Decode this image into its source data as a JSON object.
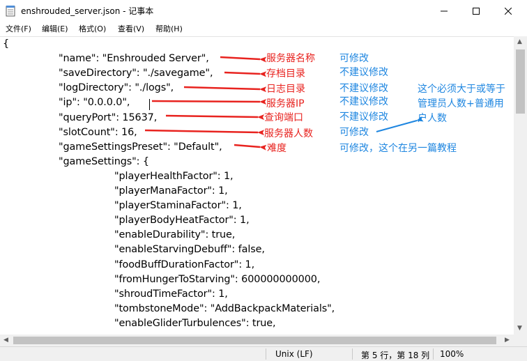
{
  "window": {
    "title": "enshrouded_server.json - 记事本",
    "buttons": {
      "minimize": "minimize",
      "maximize": "maximize",
      "close": "close"
    }
  },
  "menu": [
    "文件(F)",
    "编辑(E)",
    "格式(O)",
    "查看(V)",
    "帮助(H)"
  ],
  "editor": {
    "lines": [
      "{",
      "\t\"name\": \"Enshrouded Server\",",
      "\t\"saveDirectory\": \"./savegame\",",
      "\t\"logDirectory\": \"./logs\",",
      "\t\"ip\": \"0.0.0.0\",",
      "\t\"queryPort\": 15637,",
      "\t\"slotCount\": 16,",
      "\t\"gameSettingsPreset\": \"Default\",",
      "\t\"gameSettings\": {",
      "\t\t\"playerHealthFactor\": 1,",
      "\t\t\"playerManaFactor\": 1,",
      "\t\t\"playerStaminaFactor\": 1,",
      "\t\t\"playerBodyHeatFactor\": 1,",
      "\t\t\"enableDurability\": true,",
      "\t\t\"enableStarvingDebuff\": false,",
      "\t\t\"foodBuffDurationFactor\": 1,",
      "\t\t\"fromHungerToStarving\": 600000000000,",
      "\t\t\"shroudTimeFactor\": 1,",
      "\t\t\"tombstoneMode\": \"AddBackpackMaterials\",",
      "\t\t\"enableGliderTurbulences\": true,"
    ]
  },
  "annotations": {
    "red": [
      "服务器名称",
      "存档目录",
      "日志目录",
      "服务器IP",
      "查询端口",
      "服务器人数",
      "难度"
    ],
    "blue": [
      "可修改",
      "不建议修改",
      "不建议修改",
      "不建议修改",
      "不建议修改",
      "可修改",
      "可修改，这个在另一篇教程"
    ],
    "note": "这个必须大于或等于\n管理员人数+普通用\n户人数",
    "colors": {
      "red": "#e8231f",
      "blue": "#1e86e0"
    }
  },
  "status": {
    "encoding_eol": "Unix (LF)",
    "position": "第 5 行，第 18 列",
    "zoom": "100%"
  }
}
